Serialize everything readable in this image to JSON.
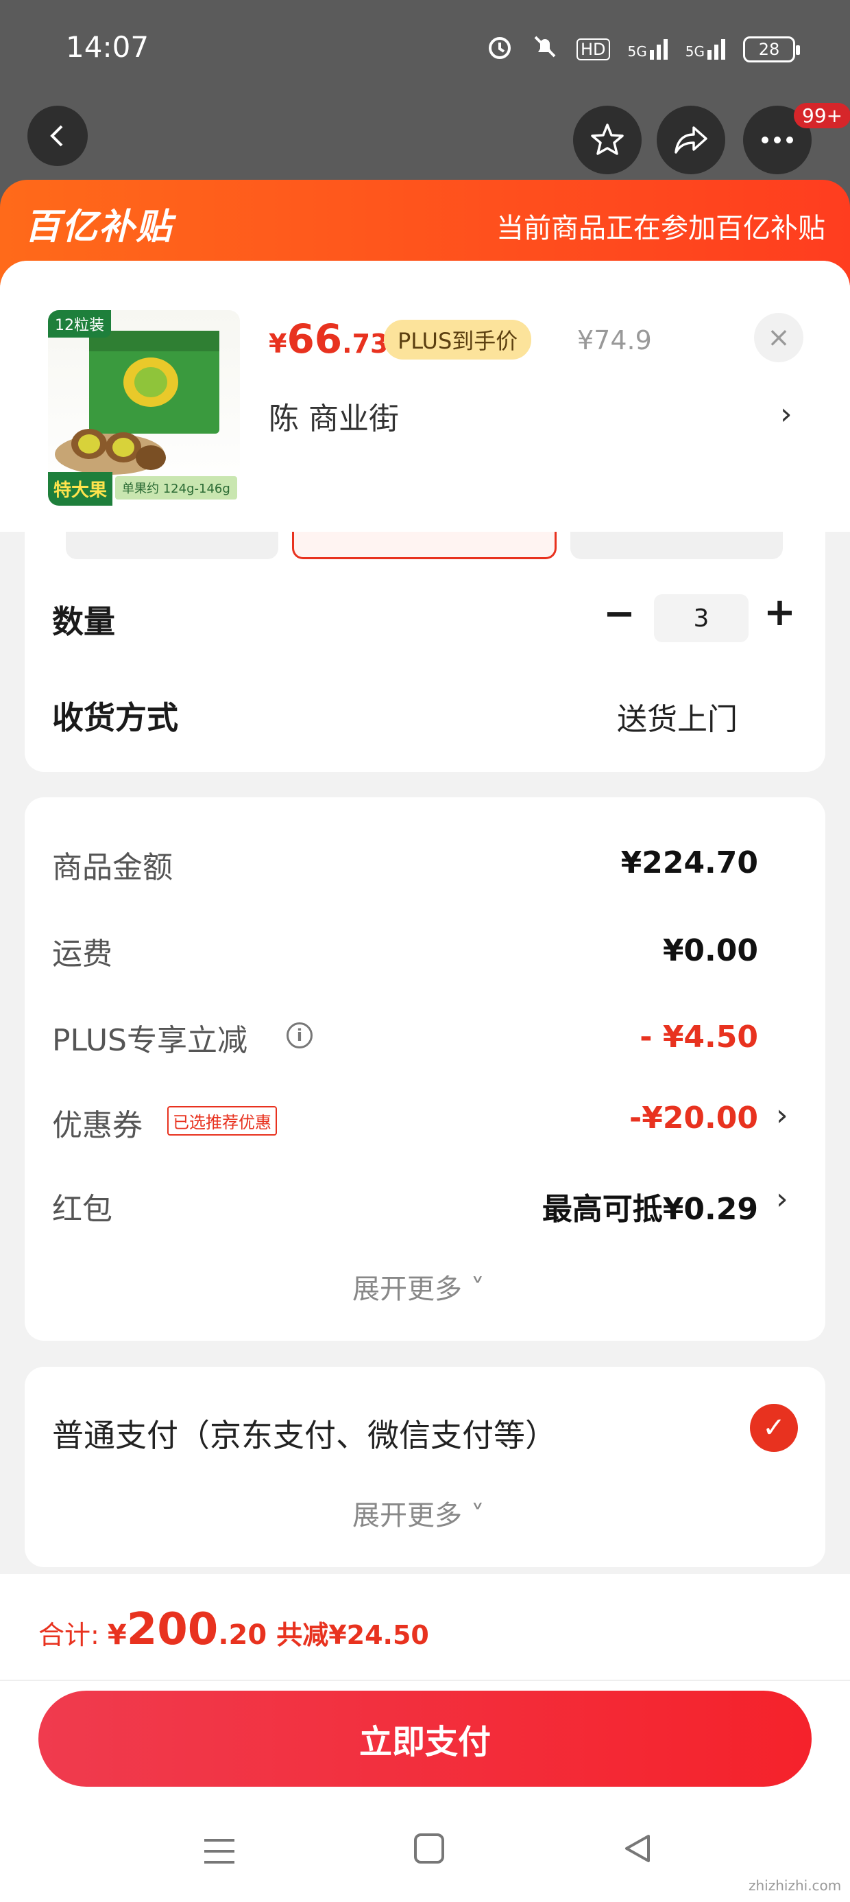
{
  "status_bar": {
    "time": "14:07",
    "network": "HD",
    "signal_1": "5G",
    "signal_2": "5G",
    "battery": "28"
  },
  "top_actions": {
    "more_badge": "99+"
  },
  "banner": {
    "logo": "百亿补贴",
    "text": "当前商品正在参加百亿补贴"
  },
  "product": {
    "image_tag": "12粒装",
    "image_big_label": "特大果",
    "image_weight": "单果约 124g-146g",
    "price_currency": "¥",
    "price_int": "66",
    "price_dec": ".73",
    "plus_label": "PLUS到手价",
    "original_price": "¥74.9",
    "close": "×",
    "address": "陈  商业街",
    "address_arrow": "›"
  },
  "quantity": {
    "label": "数量",
    "minus": "−",
    "value": "3",
    "plus": "+"
  },
  "delivery": {
    "label": "收货方式",
    "value": "送货上门"
  },
  "amounts": {
    "goods_label": "商品金额",
    "goods_value": "¥224.70",
    "shipping_label": "运费",
    "shipping_value": "¥0.00",
    "plus_discount_label": "PLUS专享立减",
    "plus_discount_value": "- ¥4.50",
    "coupon_label": "优惠券",
    "coupon_tag": "已选推荐优惠",
    "coupon_value": "-¥20.00",
    "red_packet_label": "红包",
    "red_packet_value": "最高可抵¥0.29",
    "expand": "展开更多 ˅"
  },
  "payment": {
    "method": "普通支付（京东支付、微信支付等）",
    "check": "✓",
    "expand": "展开更多 ˅"
  },
  "total": {
    "label": "合计: ",
    "currency": "¥",
    "int": "200",
    "dec": ".20",
    "saved": "共减¥24.50"
  },
  "pay_button": "立即支付",
  "watermark": "zhizhizhi.com",
  "colors": {
    "accent_red": "#e8321f",
    "banner_orange": "#ff5a1c",
    "plus_gold": "#fce39b"
  }
}
